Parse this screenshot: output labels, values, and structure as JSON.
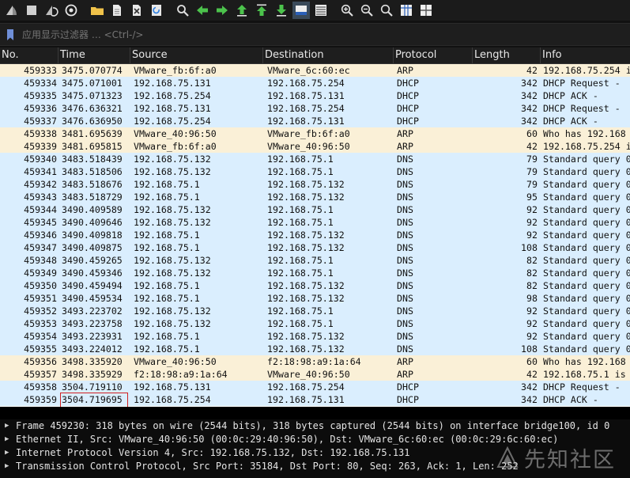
{
  "toolbar": {
    "icons": [
      "shark-fin-start-icon",
      "stop-square-icon",
      "restart-fin-icon",
      "capture-options-icon",
      "open-folder-icon",
      "file-icon",
      "close-file-icon",
      "reload-icon",
      "find-icon",
      "go-back-icon",
      "go-forward-icon",
      "go-to-packet-icon",
      "go-first-icon",
      "go-last-icon",
      "autoscroll-icon",
      "colorize-icon",
      "zoom-in-icon",
      "zoom-out-icon",
      "zoom-normal-icon",
      "resize-columns-icon",
      "layout-icon"
    ]
  },
  "filter": {
    "placeholder": "应用显示过滤器 … <Ctrl-/>"
  },
  "columns": {
    "no": "No.",
    "time": "Time",
    "source": "Source",
    "destination": "Destination",
    "protocol": "Protocol",
    "length": "Length",
    "info": "Info"
  },
  "packets": [
    {
      "no": "459333",
      "time": "3475.070774",
      "src": "VMware_fb:6f:a0",
      "dst": "VMware_6c:60:ec",
      "proto": "ARP",
      "len": "42",
      "info": "192.168.75.254 i"
    },
    {
      "no": "459334",
      "time": "3475.071001",
      "src": "192.168.75.131",
      "dst": "192.168.75.254",
      "proto": "DHCP",
      "len": "342",
      "info": "DHCP Request  -"
    },
    {
      "no": "459335",
      "time": "3475.071323",
      "src": "192.168.75.254",
      "dst": "192.168.75.131",
      "proto": "DHCP",
      "len": "342",
      "info": "DHCP ACK      -"
    },
    {
      "no": "459336",
      "time": "3476.636321",
      "src": "192.168.75.131",
      "dst": "192.168.75.254",
      "proto": "DHCP",
      "len": "342",
      "info": "DHCP Request  -"
    },
    {
      "no": "459337",
      "time": "3476.636950",
      "src": "192.168.75.254",
      "dst": "192.168.75.131",
      "proto": "DHCP",
      "len": "342",
      "info": "DHCP ACK      -"
    },
    {
      "no": "459338",
      "time": "3481.695639",
      "src": "VMware_40:96:50",
      "dst": "VMware_fb:6f:a0",
      "proto": "ARP",
      "len": "60",
      "info": "Who has 192.168"
    },
    {
      "no": "459339",
      "time": "3481.695815",
      "src": "VMware_fb:6f:a0",
      "dst": "VMware_40:96:50",
      "proto": "ARP",
      "len": "42",
      "info": "192.168.75.254 i"
    },
    {
      "no": "459340",
      "time": "3483.518439",
      "src": "192.168.75.132",
      "dst": "192.168.75.1",
      "proto": "DNS",
      "len": "79",
      "info": "Standard query 0"
    },
    {
      "no": "459341",
      "time": "3483.518506",
      "src": "192.168.75.132",
      "dst": "192.168.75.1",
      "proto": "DNS",
      "len": "79",
      "info": "Standard query 0"
    },
    {
      "no": "459342",
      "time": "3483.518676",
      "src": "192.168.75.1",
      "dst": "192.168.75.132",
      "proto": "DNS",
      "len": "79",
      "info": "Standard query 0"
    },
    {
      "no": "459343",
      "time": "3483.518729",
      "src": "192.168.75.1",
      "dst": "192.168.75.132",
      "proto": "DNS",
      "len": "95",
      "info": "Standard query 0"
    },
    {
      "no": "459344",
      "time": "3490.409589",
      "src": "192.168.75.132",
      "dst": "192.168.75.1",
      "proto": "DNS",
      "len": "92",
      "info": "Standard query 0"
    },
    {
      "no": "459345",
      "time": "3490.409646",
      "src": "192.168.75.132",
      "dst": "192.168.75.1",
      "proto": "DNS",
      "len": "92",
      "info": "Standard query 0"
    },
    {
      "no": "459346",
      "time": "3490.409818",
      "src": "192.168.75.1",
      "dst": "192.168.75.132",
      "proto": "DNS",
      "len": "92",
      "info": "Standard query 0"
    },
    {
      "no": "459347",
      "time": "3490.409875",
      "src": "192.168.75.1",
      "dst": "192.168.75.132",
      "proto": "DNS",
      "len": "108",
      "info": "Standard query 0"
    },
    {
      "no": "459348",
      "time": "3490.459265",
      "src": "192.168.75.132",
      "dst": "192.168.75.1",
      "proto": "DNS",
      "len": "82",
      "info": "Standard query 0"
    },
    {
      "no": "459349",
      "time": "3490.459346",
      "src": "192.168.75.132",
      "dst": "192.168.75.1",
      "proto": "DNS",
      "len": "82",
      "info": "Standard query 0"
    },
    {
      "no": "459350",
      "time": "3490.459494",
      "src": "192.168.75.1",
      "dst": "192.168.75.132",
      "proto": "DNS",
      "len": "82",
      "info": "Standard query 0"
    },
    {
      "no": "459351",
      "time": "3490.459534",
      "src": "192.168.75.1",
      "dst": "192.168.75.132",
      "proto": "DNS",
      "len": "98",
      "info": "Standard query 0"
    },
    {
      "no": "459352",
      "time": "3493.223702",
      "src": "192.168.75.132",
      "dst": "192.168.75.1",
      "proto": "DNS",
      "len": "92",
      "info": "Standard query 0"
    },
    {
      "no": "459353",
      "time": "3493.223758",
      "src": "192.168.75.132",
      "dst": "192.168.75.1",
      "proto": "DNS",
      "len": "92",
      "info": "Standard query 0"
    },
    {
      "no": "459354",
      "time": "3493.223931",
      "src": "192.168.75.1",
      "dst": "192.168.75.132",
      "proto": "DNS",
      "len": "92",
      "info": "Standard query 0"
    },
    {
      "no": "459355",
      "time": "3493.224012",
      "src": "192.168.75.1",
      "dst": "192.168.75.132",
      "proto": "DNS",
      "len": "108",
      "info": "Standard query 0"
    },
    {
      "no": "459356",
      "time": "3498.335920",
      "src": "VMware_40:96:50",
      "dst": "f2:18:98:a9:1a:64",
      "proto": "ARP",
      "len": "60",
      "info": "Who has 192.168"
    },
    {
      "no": "459357",
      "time": "3498.335929",
      "src": "f2:18:98:a9:1a:64",
      "dst": "VMware_40:96:50",
      "proto": "ARP",
      "len": "42",
      "info": "192.168.75.1 is"
    },
    {
      "no": "459358",
      "time": "3504.719110",
      "src": "192.168.75.131",
      "dst": "192.168.75.254",
      "proto": "DHCP",
      "len": "342",
      "info": "DHCP Request  -"
    },
    {
      "no": "459359",
      "time": "3504.719695",
      "src": "192.168.75.254",
      "dst": "192.168.75.131",
      "proto": "DHCP",
      "len": "342",
      "info": "DHCP ACK      -"
    }
  ],
  "details": [
    "Frame 459230: 318 bytes on wire (2544 bits), 318 bytes captured (2544 bits) on interface bridge100, id 0",
    "Ethernet II, Src: VMware_40:96:50 (00:0c:29:40:96:50), Dst: VMware_6c:60:ec (00:0c:29:6c:60:ec)",
    "Internet Protocol Version 4, Src: 192.168.75.132, Dst: 192.168.75.131",
    "Transmission Control Protocol, Src Port: 35184, Dst Port: 80, Seq: 263, Ack: 1, Len: 252"
  ],
  "watermark": {
    "text": "先知社区"
  },
  "colors": {
    "dhcp_dns_row": "#daeefe",
    "arp_row": "#faf0d7",
    "highlight_box": "#d02020"
  }
}
